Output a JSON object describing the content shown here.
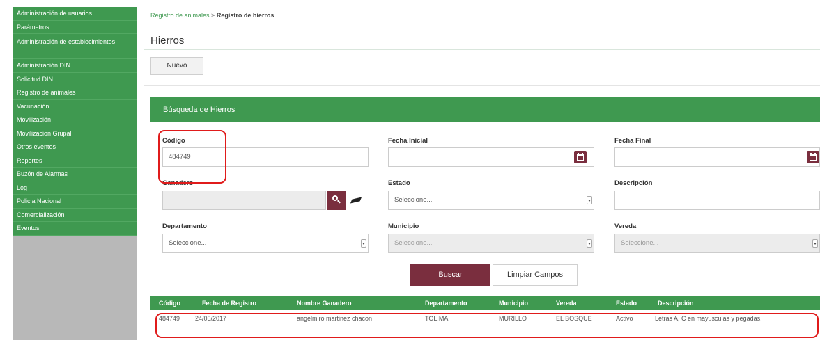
{
  "sidebar": {
    "items": [
      {
        "label": "Administración de usuarios"
      },
      {
        "label": "Parámetros"
      },
      {
        "label": "Administración de establecimientos"
      },
      {
        "label": "Administración DIN"
      },
      {
        "label": "Solicitud DIN"
      },
      {
        "label": "Registro de animales"
      },
      {
        "label": "Vacunación"
      },
      {
        "label": "Movilización"
      },
      {
        "label": "Movilizacion Grupal"
      },
      {
        "label": "Otros eventos"
      },
      {
        "label": "Reportes"
      },
      {
        "label": "Buzón de Alarmas"
      },
      {
        "label": "Log"
      },
      {
        "label": "Policia Nacional"
      },
      {
        "label": "Comercialización"
      },
      {
        "label": "Eventos"
      }
    ]
  },
  "breadcrumb": {
    "parent": "Registro de animales",
    "separator": " > ",
    "current": "Registro de hierros"
  },
  "page": {
    "title": "Hierros",
    "new_button": "Nuevo"
  },
  "search": {
    "panel_title": "Búsqueda de Hierros",
    "codigo_label": "Código",
    "codigo_value": "484749",
    "fecha_inicial_label": "Fecha Inicial",
    "fecha_final_label": "Fecha Final",
    "ganadero_label": "Ganadero",
    "estado_label": "Estado",
    "estado_value": "Seleccione...",
    "descripcion_label": "Descripción",
    "departamento_label": "Departamento",
    "departamento_value": "Seleccione...",
    "municipio_label": "Municipio",
    "municipio_value": "Seleccione...",
    "vereda_label": "Vereda",
    "vereda_value": "Seleccione...",
    "search_button": "Buscar",
    "clear_button": "Limpiar Campos"
  },
  "table": {
    "columns": [
      "Código",
      "Fecha de Registro",
      "Nombre Ganadero",
      "Departamento",
      "Municipio",
      "Vereda",
      "Estado",
      "Descripción"
    ],
    "rows": [
      [
        "484749",
        "24/05/2017",
        "angelmiro martinez chacon",
        "TOLIMA",
        "MURILLO",
        "EL BOSQUE",
        "Activo",
        "Letras A, C en mayusculas y pegadas."
      ]
    ]
  },
  "colors": {
    "primary_green": "#3f9950",
    "accent_maroon": "#7a2e3e",
    "highlight_red": "#e01b1b"
  },
  "icons": {
    "calendar": "calendar-icon",
    "search": "search-icon",
    "eraser": "eraser-icon",
    "dropdown": "chevron-down-icon"
  }
}
